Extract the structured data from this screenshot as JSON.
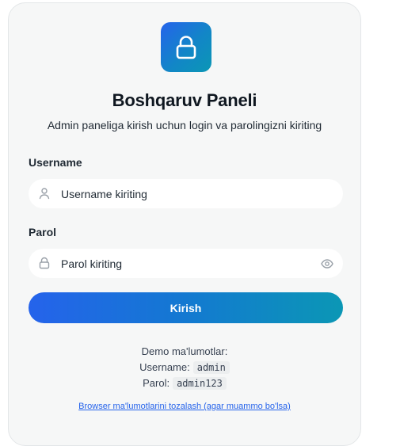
{
  "login": {
    "title": "Boshqaruv Paneli",
    "subtitle": "Admin paneliga kirish uchun login va parolingizni kiriting",
    "username_label": "Username",
    "username_placeholder": "Username kiriting",
    "password_label": "Parol",
    "password_placeholder": "Parol kiriting",
    "submit_label": "Kirish"
  },
  "demo": {
    "heading": "Demo ma'lumotlar:",
    "username_label": "Username:",
    "username_value": "admin",
    "password_label": "Parol:",
    "password_value": "admin123"
  },
  "footer": {
    "clear_link": "Browser ma'lumotlarini tozalash (agar muammo bo'lsa)"
  },
  "icons": {
    "logo": "lock-icon",
    "username_field": "user-icon",
    "password_field": "lock-icon",
    "password_toggle": "eye-icon"
  },
  "colors": {
    "accent_start": "#2563eb",
    "accent_end": "#0b97b5",
    "link": "#2563eb"
  }
}
